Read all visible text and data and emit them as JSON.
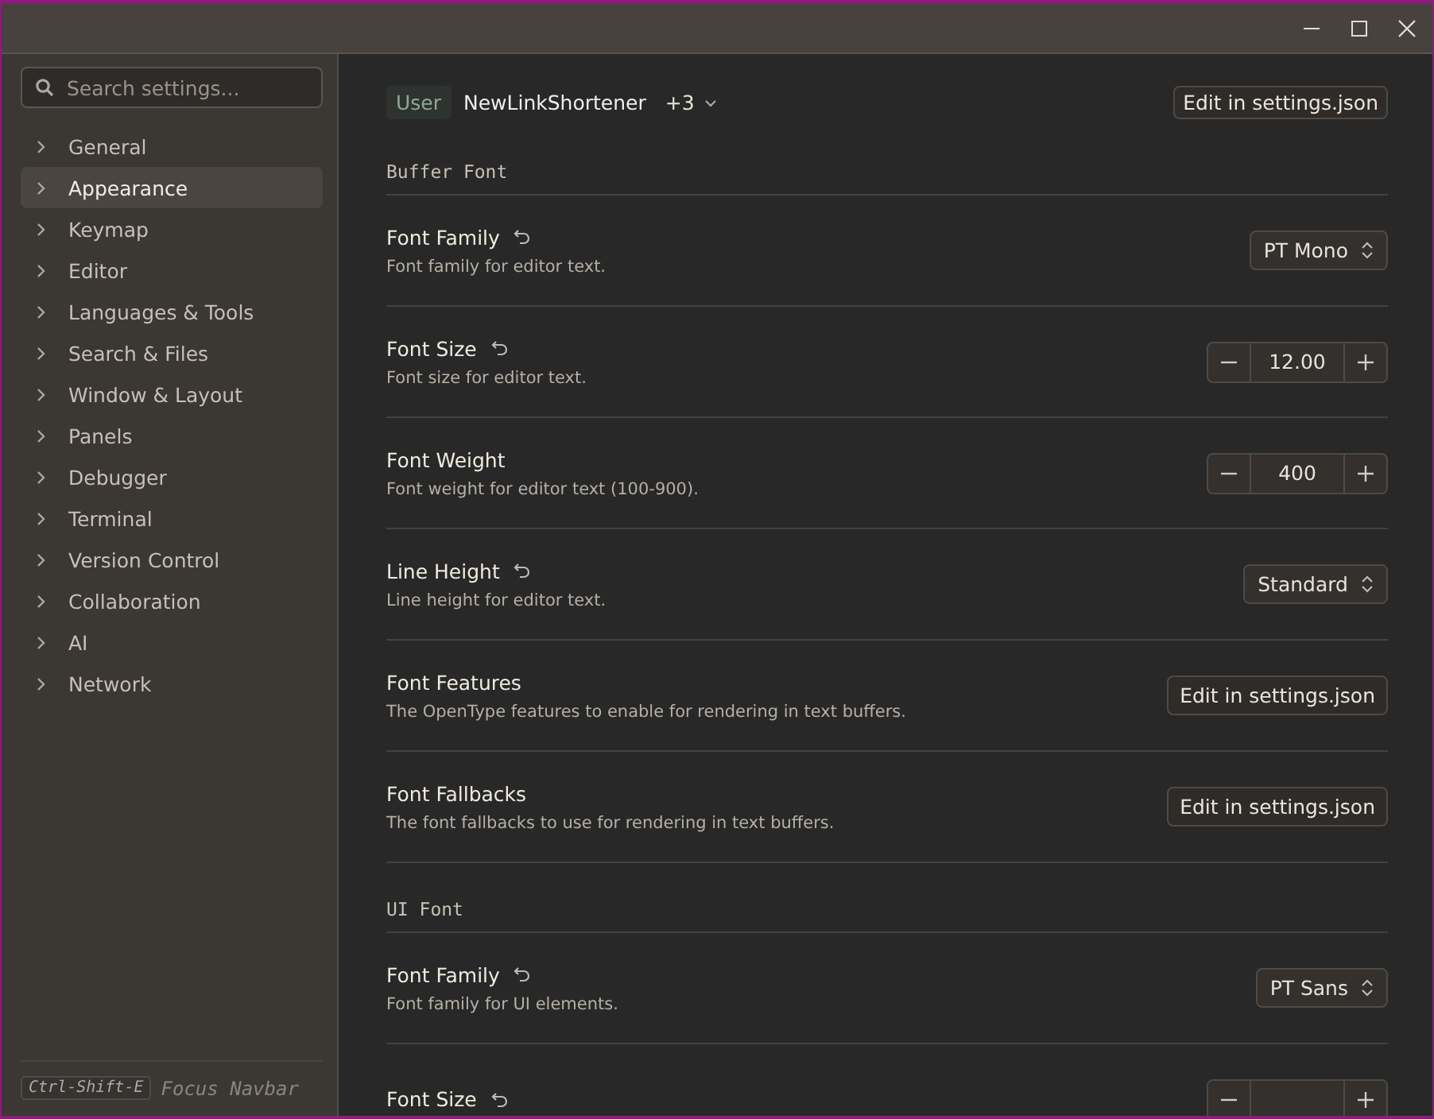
{
  "sidebar": {
    "search": {
      "placeholder": "Search settings..."
    },
    "items": [
      {
        "label": "General",
        "selected": false
      },
      {
        "label": "Appearance",
        "selected": true
      },
      {
        "label": "Keymap",
        "selected": false
      },
      {
        "label": "Editor",
        "selected": false
      },
      {
        "label": "Languages & Tools",
        "selected": false
      },
      {
        "label": "Search & Files",
        "selected": false
      },
      {
        "label": "Window & Layout",
        "selected": false
      },
      {
        "label": "Panels",
        "selected": false
      },
      {
        "label": "Debugger",
        "selected": false
      },
      {
        "label": "Terminal",
        "selected": false
      },
      {
        "label": "Version Control",
        "selected": false
      },
      {
        "label": "Collaboration",
        "selected": false
      },
      {
        "label": "AI",
        "selected": false
      },
      {
        "label": "Network",
        "selected": false
      }
    ],
    "footer": {
      "shortcut": "Ctrl-Shift-E",
      "label": "Focus Navbar"
    }
  },
  "header": {
    "scope": "User",
    "project": "NewLinkShortener",
    "more": "+3",
    "button": "Edit in settings.json"
  },
  "sections": [
    {
      "title": "Buffer Font",
      "settings": [
        {
          "title": "Font Family",
          "description": "Font family for editor text.",
          "modified": true,
          "control": {
            "kind": "dropdown",
            "value": "PT Mono"
          }
        },
        {
          "title": "Font Size",
          "description": "Font size for editor text.",
          "modified": true,
          "control": {
            "kind": "stepper",
            "value": "12.00"
          }
        },
        {
          "title": "Font Weight",
          "description": "Font weight for editor text (100-900).",
          "modified": false,
          "control": {
            "kind": "stepper",
            "value": "400"
          }
        },
        {
          "title": "Line Height",
          "description": "Line height for editor text.",
          "modified": true,
          "control": {
            "kind": "dropdown",
            "value": "Standard"
          }
        },
        {
          "title": "Font Features",
          "description": "The OpenType features to enable for rendering in text buffers.",
          "modified": false,
          "control": {
            "kind": "button",
            "value": "Edit in settings.json"
          }
        },
        {
          "title": "Font Fallbacks",
          "description": "The font fallbacks to use for rendering in text buffers.",
          "modified": false,
          "control": {
            "kind": "button",
            "value": "Edit in settings.json"
          }
        }
      ]
    },
    {
      "title": "UI Font",
      "settings": [
        {
          "title": "Font Family",
          "description": "Font family for UI elements.",
          "modified": true,
          "control": {
            "kind": "dropdown",
            "value": "PT Sans"
          }
        },
        {
          "title": "Font Size",
          "modified": true,
          "control": {
            "kind": "stepper"
          }
        }
      ]
    }
  ]
}
